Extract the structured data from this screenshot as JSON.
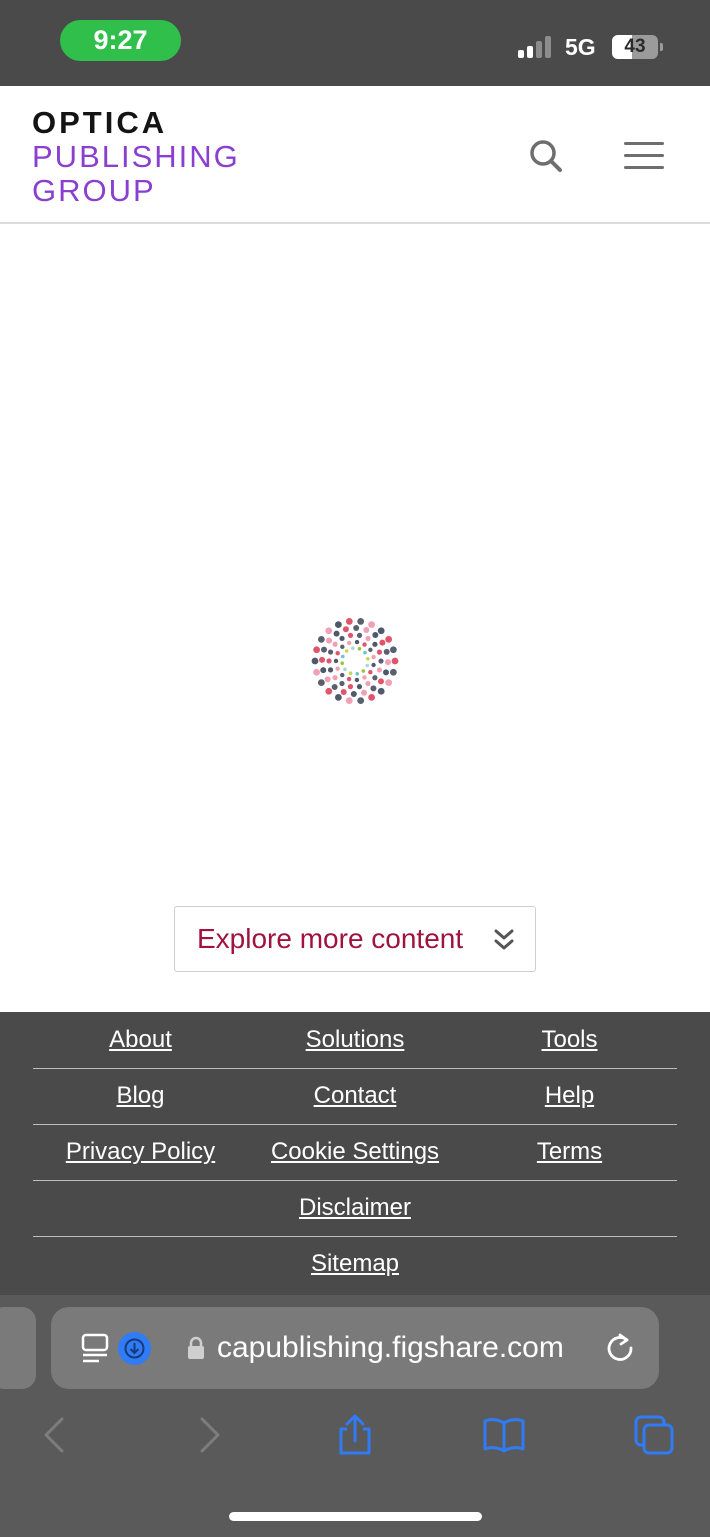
{
  "status_bar": {
    "time": "9:27",
    "network": "5G",
    "battery_percent": "43",
    "battery_level": 0.43,
    "signal_bars_active": 2,
    "colors": {
      "time_pill": "#2fbf4a",
      "bar_bg": "#4a4a4a"
    }
  },
  "header": {
    "logo_line1": "OPTICA",
    "logo_line2": "PUBLISHING",
    "logo_line3": "GROUP",
    "search_icon": "search-icon",
    "menu_icon": "hamburger-menu-icon",
    "colors": {
      "logo_dark": "#141414",
      "logo_accent": "#8a3fd1"
    }
  },
  "main": {
    "loading_icon": "loading-spinner-icon",
    "explore_button": {
      "label": "Explore more content",
      "icon": "double-chevron-down-icon"
    },
    "colors": {
      "explore_text": "#a0123f"
    }
  },
  "footer": {
    "rows": [
      [
        "About",
        "Solutions",
        "Tools"
      ],
      [
        "Blog",
        "Contact",
        "Help"
      ],
      [
        "Privacy Policy",
        "Cookie Settings",
        "Terms"
      ],
      [
        "Disclaimer"
      ],
      [
        "Sitemap"
      ]
    ],
    "colors": {
      "bg": "#4a4a4a"
    }
  },
  "browser": {
    "url": "capublishing.figshare.com",
    "icons": [
      "reader-mode-icon",
      "download-icon",
      "lock-icon",
      "reload-icon"
    ],
    "toolbar": [
      "back-icon",
      "forward-icon",
      "share-icon",
      "bookmarks-icon",
      "tabs-icon"
    ],
    "colors": {
      "accent": "#2f7cf6"
    }
  }
}
